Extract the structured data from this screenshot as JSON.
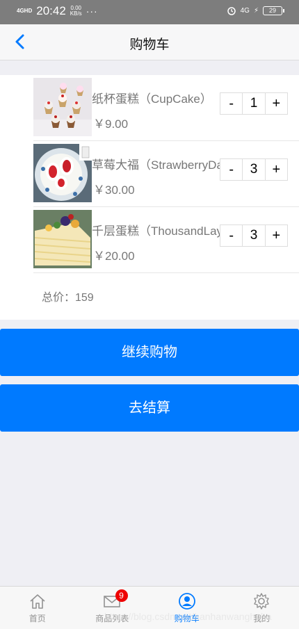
{
  "status_bar": {
    "network": "4GHD",
    "time": "20:42",
    "speed_value": "0.00",
    "speed_unit": "KB/s",
    "more": "···",
    "network_right": "4G",
    "battery": "29"
  },
  "header": {
    "title": "购物车"
  },
  "cart": {
    "items": [
      {
        "name": "纸杯蛋糕（CupCake）",
        "price": "￥9.00",
        "quantity": "1",
        "minus": "-",
        "plus": "+"
      },
      {
        "name": "草莓大福（StrawberryDafu）",
        "price": "￥30.00",
        "quantity": "3",
        "minus": "-",
        "plus": "+"
      },
      {
        "name": "千层蛋糕（ThousandLayerCake）",
        "price": "￥20.00",
        "quantity": "3",
        "minus": "-",
        "plus": "+"
      }
    ],
    "total": "总价：159"
  },
  "buttons": {
    "continue_shopping": "继续购物",
    "checkout": "去结算"
  },
  "tabbar": {
    "tabs": [
      {
        "label": "首页"
      },
      {
        "label": "商品列表",
        "badge": "9"
      },
      {
        "label": "购物车"
      },
      {
        "label": "我的"
      }
    ]
  },
  "watermark": "https://blog.csdn.net/hanhanwanghaha",
  "colors": {
    "accent": "#007aff",
    "badge": "#ee0000",
    "background": "#efeff4"
  }
}
